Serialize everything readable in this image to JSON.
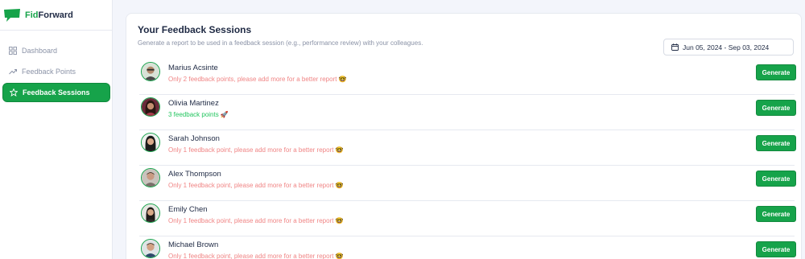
{
  "app": {
    "name_part1": "Fid",
    "name_part2": "Forward",
    "accent_color": "#16a34a"
  },
  "sidebar": {
    "items": [
      {
        "label": "Dashboard",
        "icon": "grid-icon",
        "active": false
      },
      {
        "label": "Feedback Points",
        "icon": "trend-icon",
        "active": false
      },
      {
        "label": "Feedback Sessions",
        "icon": "star-icon",
        "active": true
      }
    ]
  },
  "main": {
    "title": "Your Feedback Sessions",
    "subtitle": "Generate a report to be used in a feedback session (e.g., performance review) with your colleagues.",
    "date_range": "Jun 05, 2024 - Sep 03, 2024",
    "generate_label": "Generate",
    "people": [
      {
        "name": "Marius Acsinte",
        "status": "Only 2 feedback points, please add more for a better report 🤓",
        "status_type": "warning"
      },
      {
        "name": "Olivia Martinez",
        "status": "3 feedback points 🚀",
        "status_type": "ok"
      },
      {
        "name": "Sarah Johnson",
        "status": "Only 1 feedback point, please add more for a better report 🤓",
        "status_type": "warning"
      },
      {
        "name": "Alex Thompson",
        "status": "Only 1 feedback point, please add more for a better report 🤓",
        "status_type": "warning"
      },
      {
        "name": "Emily Chen",
        "status": "Only 1 feedback point, please add more for a better report 🤓",
        "status_type": "warning"
      },
      {
        "name": "Michael Brown",
        "status": "Only 1 feedback point, please add more for a better report 🤓",
        "status_type": "warning"
      }
    ]
  }
}
